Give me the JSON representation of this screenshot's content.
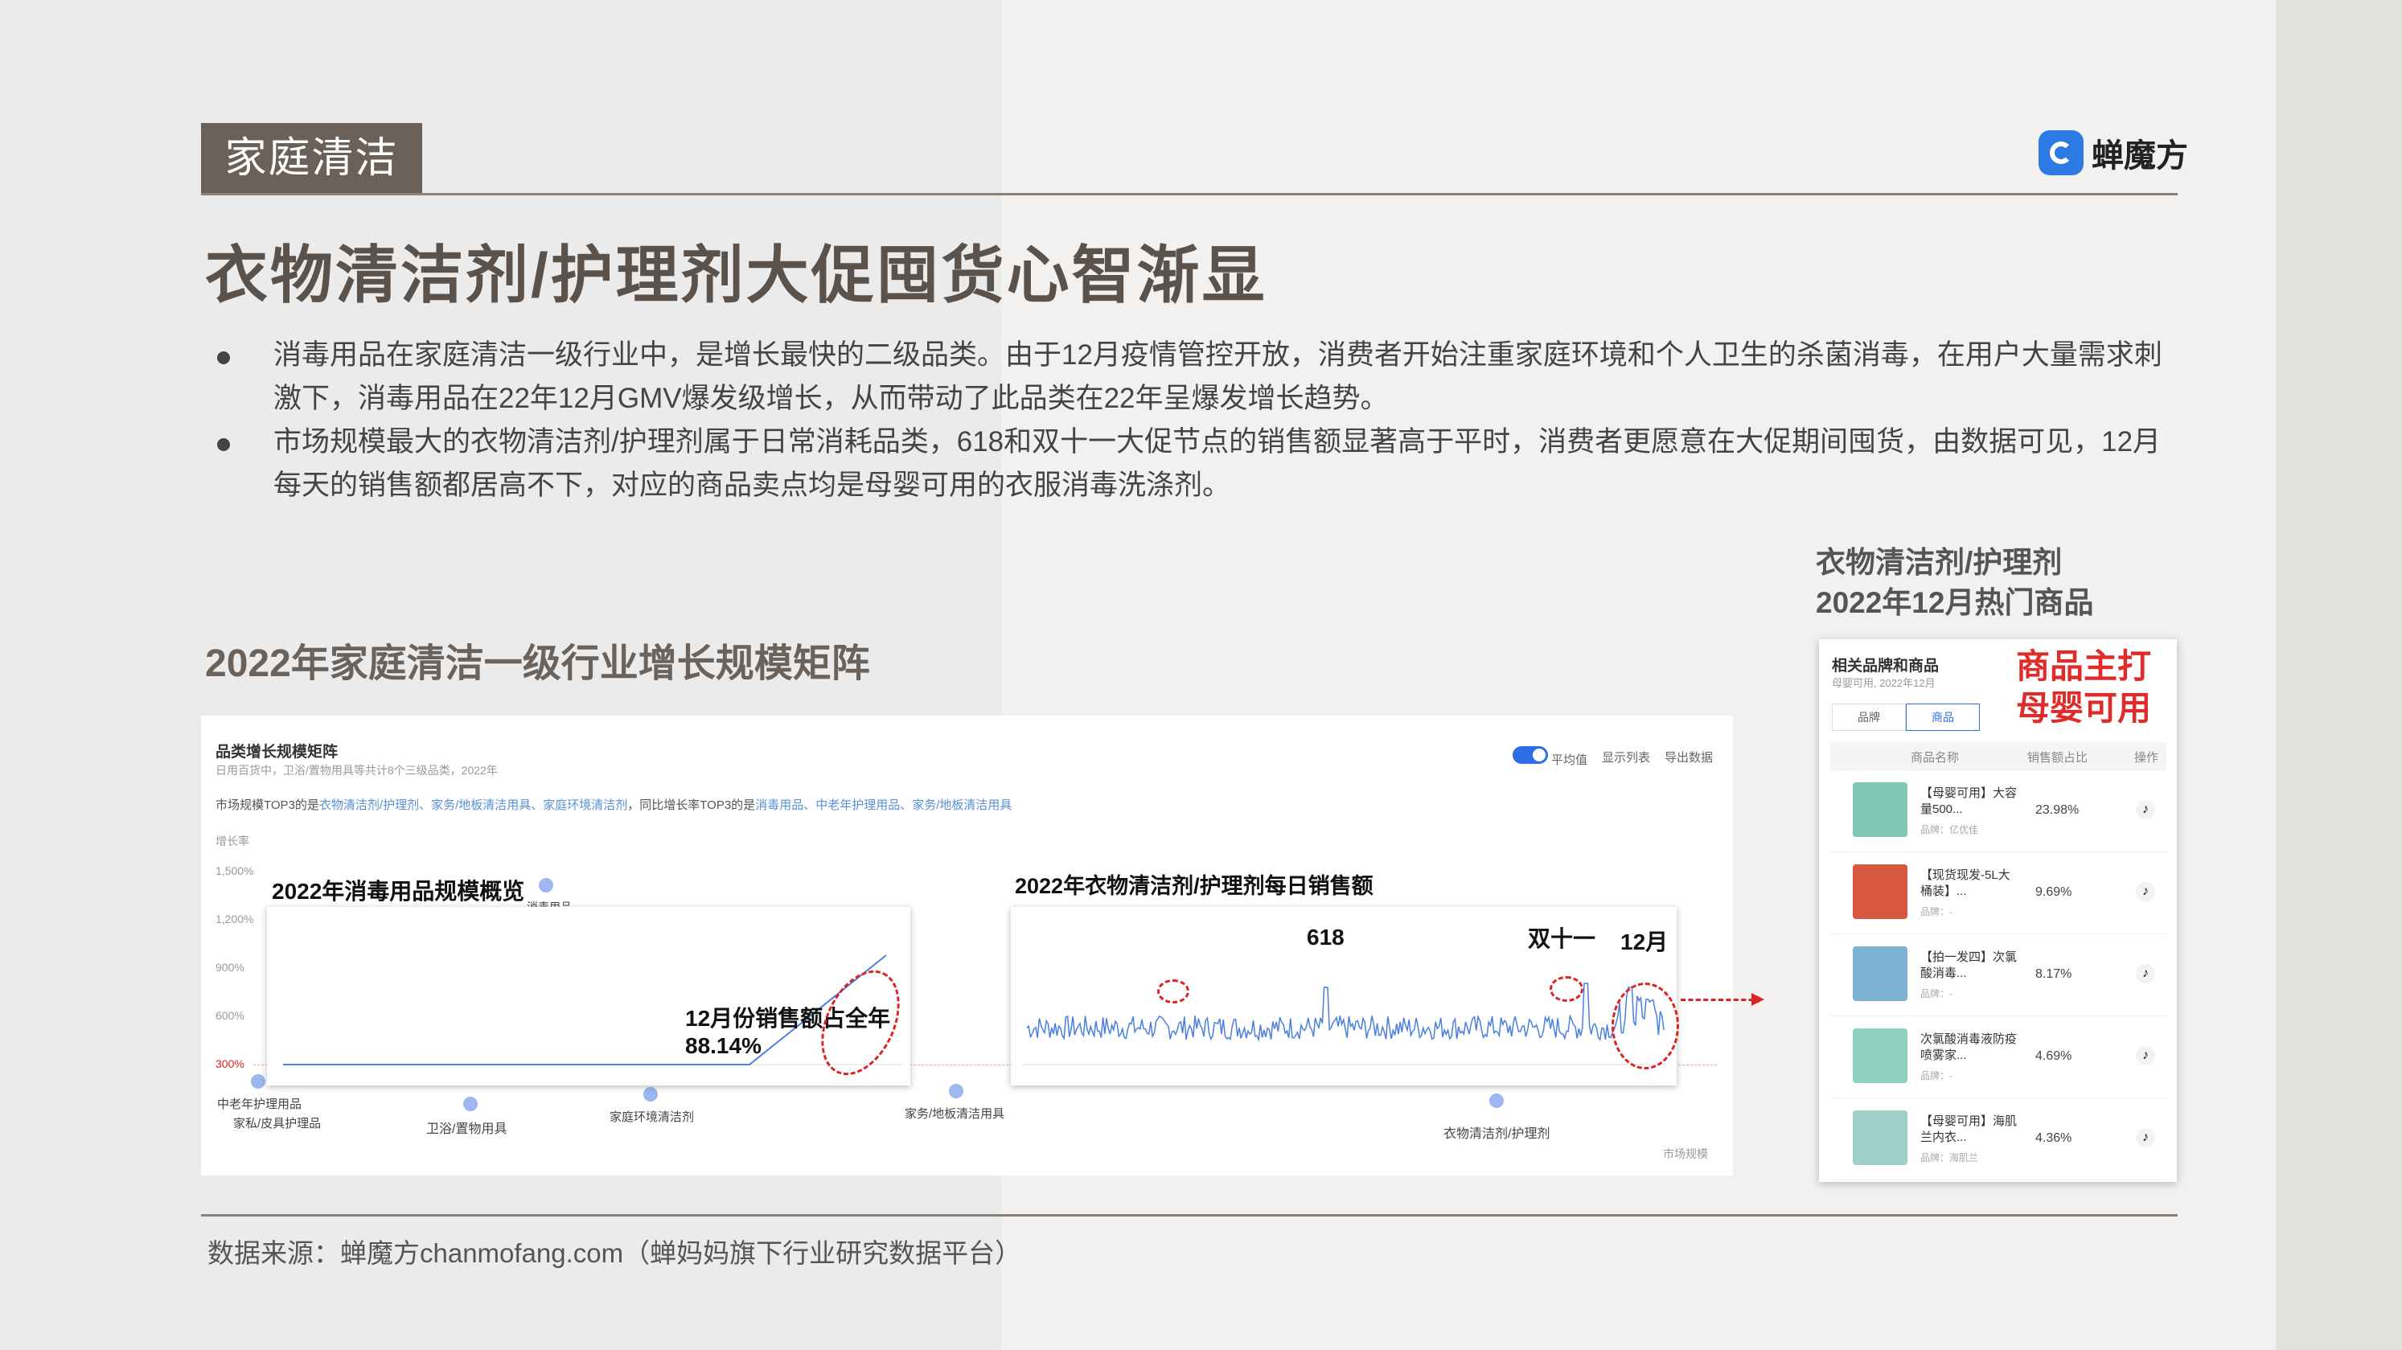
{
  "header": {
    "tag": "家庭清洁",
    "logo_text": "蝉魔方",
    "title": "衣物清洁剂/护理剂大促囤货心智渐显"
  },
  "bullets": [
    "消毒用品在家庭清洁一级行业中，是增长最快的二级品类。由于12月疫情管控开放，消费者开始注重家庭环境和个人卫生的杀菌消毒，在用户大量需求刺激下，消毒用品在22年12月GMV爆发级增长，从而带动了此品类在22年呈爆发增长趋势。",
    "市场规模最大的衣物清洁剂/护理剂属于日常消耗品类，618和双十一大促节点的销售额显著高于平时，消费者更愿意在大促期间囤货，由数据可见，12月每天的销售额都居高不下，对应的商品卖点均是母婴可用的衣服消毒洗涤剂。"
  ],
  "section_title": "2022年家庭清洁一级行业增长规模矩阵",
  "right_title": [
    "衣物清洁剂/护理剂",
    "2022年12月热门商品"
  ],
  "matrix": {
    "header": "品类增长规模矩阵",
    "sub": "日用百货中，卫浴/置物用具等共计8个三级品类，2022年",
    "desc_prefix": "市场规模TOP3的是",
    "desc_top3": "衣物清洁剂/护理剂、家务/地板清洁用具、家庭环境清洁剂",
    "desc_mid": "，同比增长率TOP3的是",
    "desc_growth3": "消毒用品、中老年护理用品、家务/地板清洁用具",
    "controls": [
      "平均值",
      "显示列表",
      "导出数据"
    ],
    "y_title": "增长率",
    "y_ticks": [
      "1,500%",
      "1,200%",
      "900%",
      "600%",
      "300%"
    ],
    "x_title": "市场规模",
    "categories": [
      "消毒用品",
      "中老年护理用品",
      "家私/皮具护理品",
      "卫浴/置物用具",
      "家庭环境清洁剂",
      "家务/地板清洁用具",
      "衣物清洁剂/护理剂"
    ]
  },
  "overlay1": {
    "title": "2022年消毒用品规模概览",
    "callout_line1": "12月份销售额占全年",
    "callout_pct": "88.14%"
  },
  "overlay2": {
    "title": "2022年衣物清洁剂/护理剂每日销售额",
    "ann_618": "618",
    "ann_1111": "双十一",
    "ann_dec": "12月"
  },
  "panel": {
    "title": "相关品牌和商品",
    "sub": "母婴可用, 2022年12月",
    "red_line1": "商品主打",
    "red_line2": "母婴可用",
    "tabs": [
      "品牌",
      "商品"
    ],
    "cols": [
      "商品名称",
      "销售额占比",
      "操作"
    ],
    "products": [
      {
        "name": "【母婴可用】大容量500...",
        "brand": "品牌：亿优佳",
        "share": "23.98%",
        "color": "#7fc8b6"
      },
      {
        "name": "【现货现发-5L大桶装】...",
        "brand": "品牌：-",
        "share": "9.69%",
        "color": "#d8583f"
      },
      {
        "name": "【拍一发四】次氯酸消毒...",
        "brand": "品牌：-",
        "share": "8.17%",
        "color": "#7fb3d6"
      },
      {
        "name": "次氯酸消毒液防疫喷雾家...",
        "brand": "品牌：-",
        "share": "4.69%",
        "color": "#8fd1c0"
      },
      {
        "name": "【母婴可用】海肌兰内衣...",
        "brand": "品牌：海肌兰",
        "share": "4.36%",
        "color": "#9ed0c8"
      }
    ]
  },
  "source": "数据来源：蝉魔方chanmofang.com（蝉妈妈旗下行业研究数据平台）"
}
